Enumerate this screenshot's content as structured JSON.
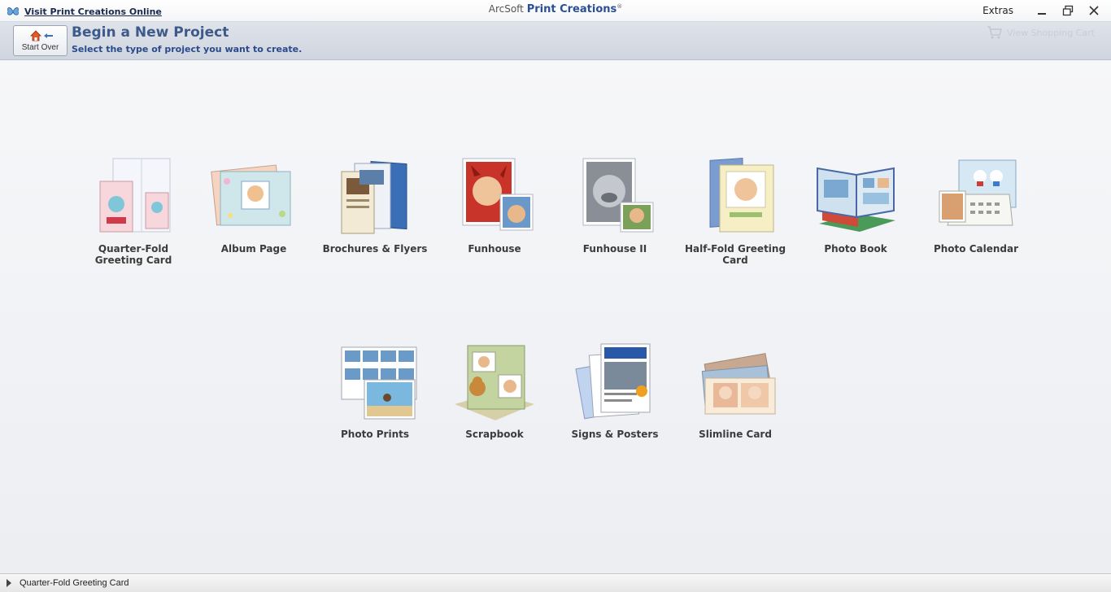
{
  "titlebar": {
    "link": "Visit Print Creations Online",
    "brand_prefix": "ArcSoft",
    "brand_name": "Print Creations",
    "brand_mark": "®",
    "extras": "Extras"
  },
  "header": {
    "start_over": "Start Over",
    "title": "Begin a New Project",
    "subtitle": "Select the type of project you want to create.",
    "cart": "View Shopping Cart"
  },
  "projects": [
    "Quarter-Fold Greeting Card",
    "Album Page",
    "Brochures & Flyers",
    "Funhouse",
    "Funhouse II",
    "Half-Fold Greeting Card",
    "Photo Book",
    "Photo Calendar",
    "Photo Prints",
    "Scrapbook",
    "Signs & Posters",
    "Slimline Card"
  ],
  "status": {
    "text": "Quarter-Fold Greeting Card"
  }
}
